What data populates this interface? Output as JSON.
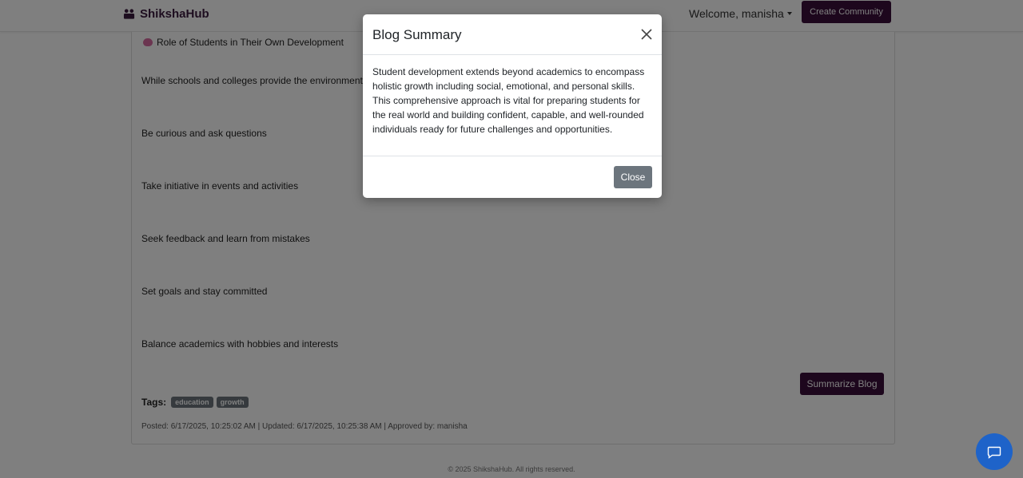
{
  "navbar": {
    "brand": "ShikshaHub",
    "welcome": "Welcome, manisha",
    "create_community": "Create Community"
  },
  "post": {
    "heading": "Role of Students in Their Own Development",
    "paragraphs": [
      "While schools and colleges provide the environment",
      "Be curious and ask questions",
      "Take initiative in events and activities",
      "Seek feedback and learn from mistakes",
      "Set goals and stay committed",
      "Balance academics with hobbies and interests"
    ],
    "summarize_label": "Summarize Blog",
    "tags_label": "Tags:",
    "tags": [
      "education",
      "growth"
    ],
    "meta": "Posted: 6/17/2025, 10:25:02 AM | Updated: 6/17/2025, 10:25:38 AM | Approved by: manisha"
  },
  "footer": "© 2025 ShikshaHub. All rights reserved.",
  "modal": {
    "title": "Blog Summary",
    "body": "Student development extends beyond academics to encompass holistic growth including social, emotional, and personal skills. This comprehensive approach is vital for preparing students for the real world and building confident, capable, and well-rounded individuals ready for future challenges and opportunities.",
    "close_label": "Close"
  },
  "icons": {
    "brand": "users-icon",
    "heading": "brain-icon",
    "modal_close": "close-icon",
    "chat": "chat-icon"
  },
  "colors": {
    "brand": "#3b0f3b",
    "secondary": "#6c757d",
    "chat": "#1e63c9"
  }
}
